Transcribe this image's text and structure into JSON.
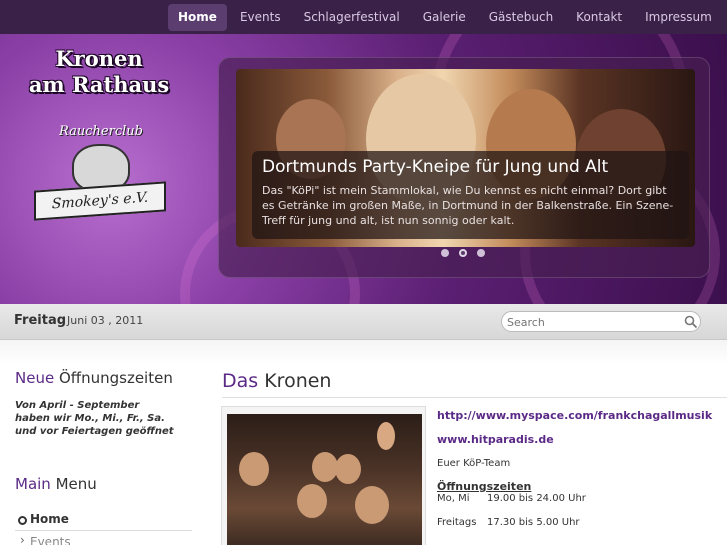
{
  "nav": {
    "items": [
      {
        "label": "Home",
        "active": true
      },
      {
        "label": "Events"
      },
      {
        "label": "Schlagerfestival"
      },
      {
        "label": "Galerie"
      },
      {
        "label": "Gästebuch"
      },
      {
        "label": "Kontakt"
      },
      {
        "label": "Impressum"
      }
    ]
  },
  "header": {
    "logo_line1": "Kronen",
    "logo_line2": "am Rathaus",
    "badge_club": "Raucherclub",
    "badge_name": "Smokey's e.V."
  },
  "slider": {
    "title": "Dortmunds Party-Kneipe für Jung und Alt",
    "text": "Das \"KöPi\" ist mein Stammlokal, wie Du kennst es nicht einmal? Dort gibt es Getränke im großen Maße, in Dortmund in der Balkenstraße. Ein Szene-Treff für jung und alt, ist nun sonnig oder kalt.",
    "dots": 3,
    "active_dot": 2
  },
  "datebar": {
    "day": "Freitag",
    "date": "Juni 03 , 2011",
    "search_placeholder": "Search"
  },
  "sidebar": {
    "hours_accent": "Neue",
    "hours_rest": " Öffnungszeiten",
    "hours_line1": "Von April - September",
    "hours_line2": "haben wir Mo., Mi., Fr., Sa.",
    "hours_line3": "und vor Feiertagen geöffnet",
    "menu_accent": "Main",
    "menu_rest": " Menu",
    "menu_items": [
      {
        "label": "Home",
        "active": true
      },
      {
        "label": "Events"
      }
    ]
  },
  "main": {
    "title_accent": "Das",
    "title_rest": " Kronen",
    "link1": "http://www.myspace.com/frankchagallmusik",
    "link2": "www.hitparadis.de",
    "team": "Euer KöP-Team",
    "hours_heading": "Öffnungszeiten",
    "row1_days": "Mo, Mi",
    "row1_hours": "19.00  bis 24.00 Uhr",
    "row2_days": "Freitags",
    "row2_hours": "17.30  bis  5.00 Uhr"
  },
  "colors": {
    "accent": "#5b2a87",
    "nav_bg": "#3a2148",
    "nav_active": "#5b3d6f"
  }
}
